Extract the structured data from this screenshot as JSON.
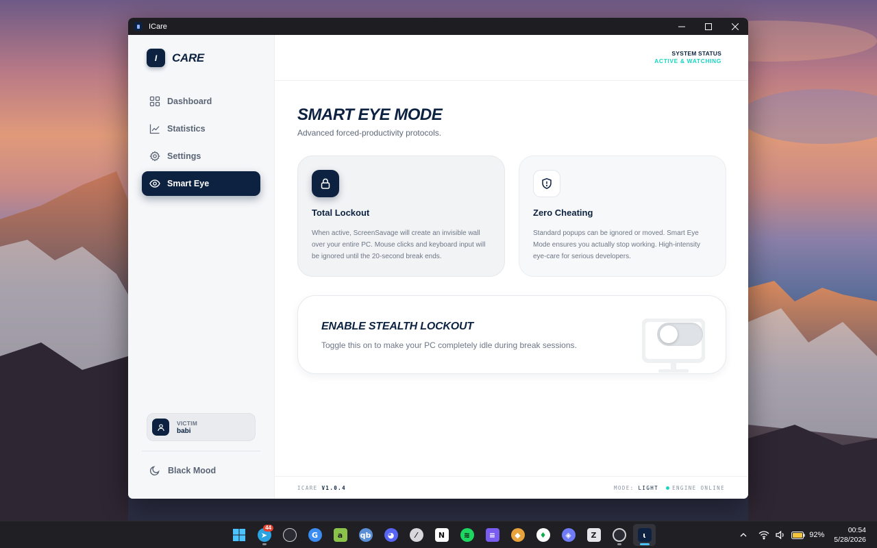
{
  "window": {
    "title": "ICare"
  },
  "sidebar": {
    "brand_mark": "I",
    "brand_name": "CARE",
    "items": [
      {
        "label": "Dashboard",
        "icon": "grid-icon",
        "active": false
      },
      {
        "label": "Statistics",
        "icon": "chart-line-icon",
        "active": false
      },
      {
        "label": "Settings",
        "icon": "gear-icon",
        "active": false
      },
      {
        "label": "Smart Eye",
        "icon": "eye-icon",
        "active": true
      }
    ],
    "user": {
      "role": "VICTIM",
      "name": "babi"
    },
    "theme_toggle": "Black Mood"
  },
  "header": {
    "status_label": "SYSTEM STATUS",
    "status_value": "ACTIVE & WATCHING"
  },
  "main": {
    "title": "SMART EYE MODE",
    "subtitle": "Advanced forced-productivity protocols.",
    "cards": [
      {
        "icon": "lock-icon",
        "title": "Total Lockout",
        "text": "When active, ScreenSavage will create an invisible wall over your entire PC. Mouse clicks and keyboard input will be ignored until the 20-second break ends."
      },
      {
        "icon": "shield-alert-icon",
        "title": "Zero Cheating",
        "text": "Standard popups can be ignored or moved. Smart Eye Mode ensures you actually stop working. High-intensity eye-care for serious developers."
      }
    ],
    "stealth": {
      "title": "ENABLE STEALTH LOCKOUT",
      "subtitle": "Toggle this on to make your PC completely idle during break sessions.",
      "enabled": false
    }
  },
  "footer": {
    "version_prefix": "ICARE",
    "version": "V1.0.4",
    "mode_prefix": "MODE:",
    "mode": "LIGHT",
    "engine": "ENGINE ONLINE"
  },
  "taskbar": {
    "apps": [
      {
        "name": "start-icon"
      },
      {
        "name": "telegram-icon",
        "badge": "44"
      },
      {
        "name": "browser-icon"
      },
      {
        "name": "google-icon"
      },
      {
        "name": "ageedit-icon"
      },
      {
        "name": "qbittorrent-icon"
      },
      {
        "name": "discord-icon"
      },
      {
        "name": "linear-icon"
      },
      {
        "name": "notion-icon"
      },
      {
        "name": "spotify-icon"
      },
      {
        "name": "notes-icon"
      },
      {
        "name": "dog-icon"
      },
      {
        "name": "mongodb-icon"
      },
      {
        "name": "app-icon"
      },
      {
        "name": "zed-icon"
      },
      {
        "name": "obs-icon"
      },
      {
        "name": "icare-icon"
      }
    ],
    "battery": "92%",
    "time": "00:54",
    "date": "5/28/2026"
  },
  "colors": {
    "navy": "#0c2240",
    "accent_teal": "#16d6c2",
    "sidebar_bg": "#f6f7f9"
  }
}
